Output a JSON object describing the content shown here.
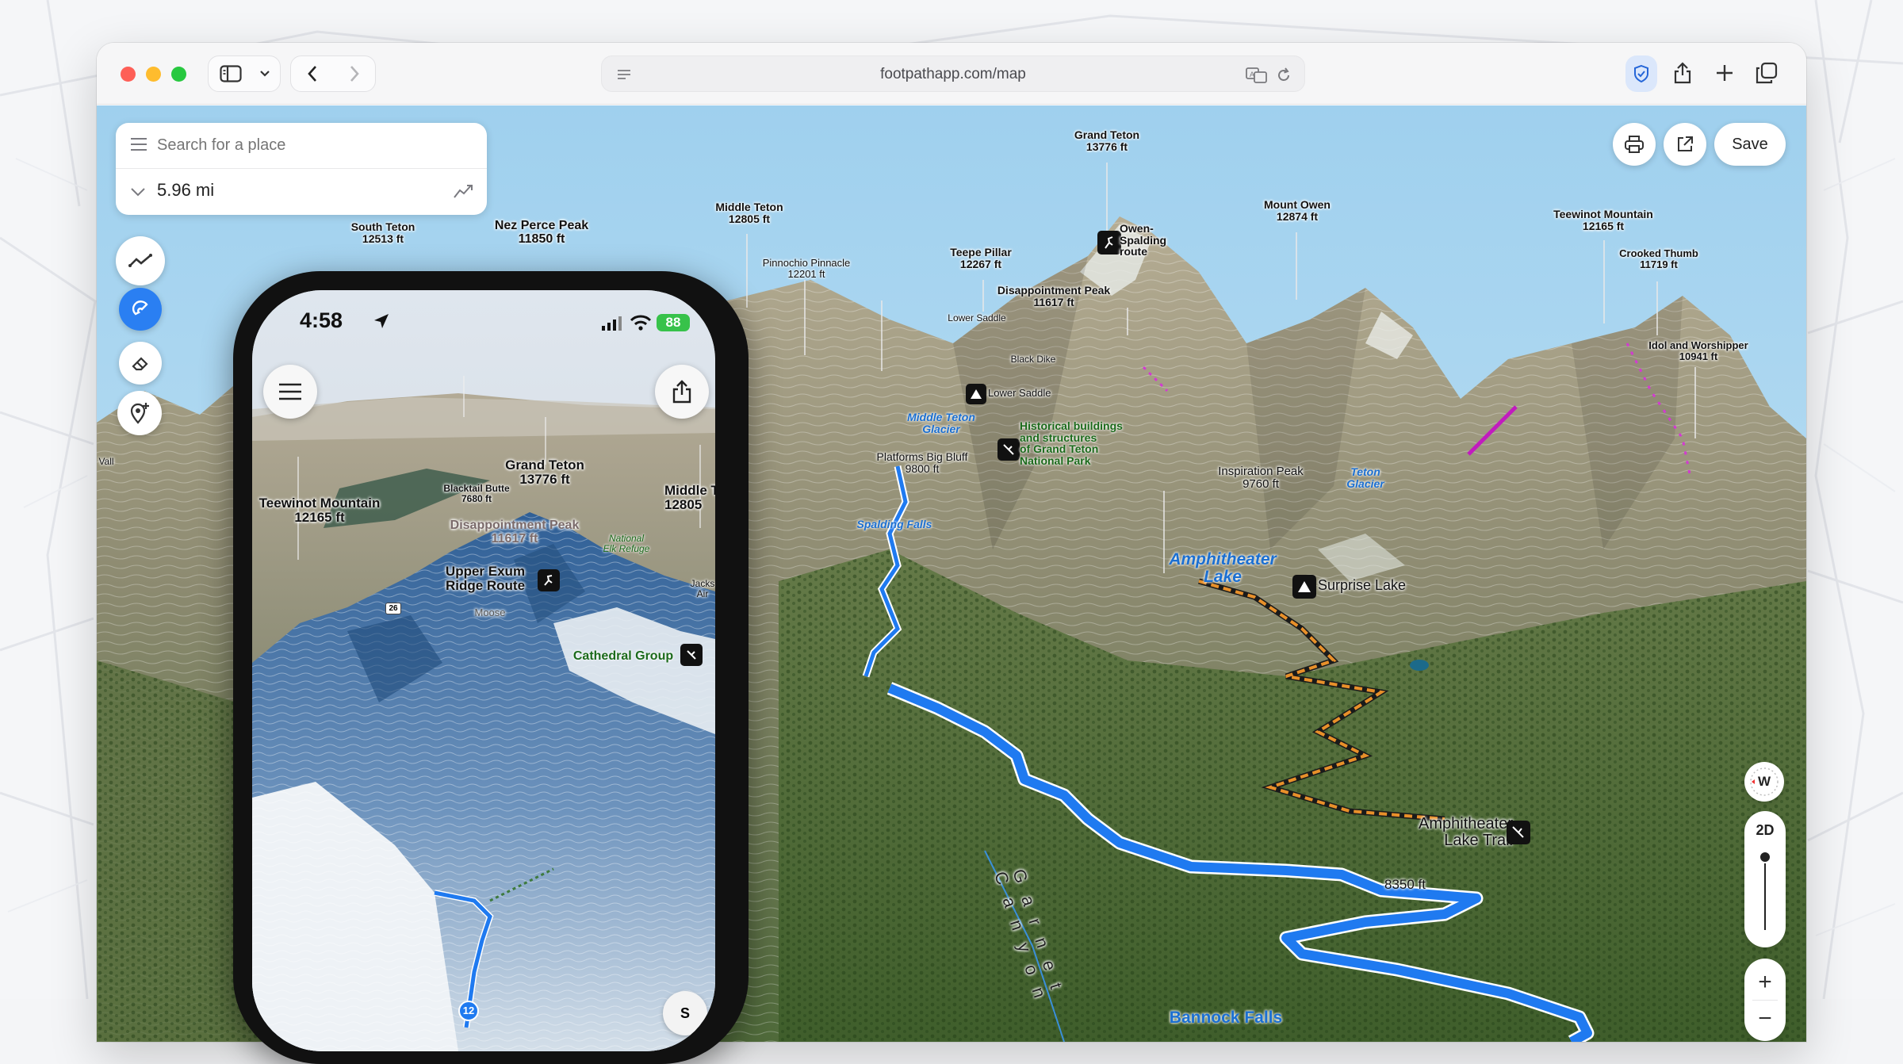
{
  "browser": {
    "url": "footpathapp.com/map"
  },
  "search": {
    "placeholder": "Search for a place",
    "distance": "5.96 mi"
  },
  "toolbar": {
    "save_label": "Save"
  },
  "map_controls": {
    "compass_heading": "W",
    "view_mode": "2D",
    "zoom_in": "+",
    "zoom_out": "−"
  },
  "map_labels": {
    "grand_teton": [
      "Grand Teton",
      "13776 ft"
    ],
    "middle_teton": [
      "Middle Teton",
      "12805 ft"
    ],
    "south_teton": [
      "South Teton",
      "12513 ft"
    ],
    "nez_perce": [
      "Nez Perce Peak",
      "11850 ft"
    ],
    "pinnochio": [
      "Pinnochio Pinnacle",
      "12201 ft"
    ],
    "teepe": [
      "Teepe Pillar",
      "12267 ft"
    ],
    "disappointment": [
      "Disappointment Peak",
      "11617 ft"
    ],
    "owen_spalding": [
      "Owen-",
      "Spalding",
      "route"
    ],
    "mount_owen": [
      "Mount Owen",
      "12874 ft"
    ],
    "teewinot": [
      "Teewinot Mountain",
      "12165 ft"
    ],
    "crooked_thumb": [
      "Crooked Thumb",
      "11719 ft"
    ],
    "idol": [
      "Idol and Worshipper",
      "10941 ft"
    ],
    "lower_saddle_top": "Lower Saddle",
    "black_dike": "Black Dike",
    "lower_saddle": "Lower Saddle",
    "middle_teton_glacier": [
      "Middle Teton",
      "Glacier"
    ],
    "historical": [
      "Historical buildings",
      "and structures",
      "of Grand Teton",
      "National Park"
    ],
    "platforms": [
      "Platforms Big Bluff",
      "9800 ft"
    ],
    "spalding_falls": "Spalding Falls",
    "inspiration": [
      "Inspiration Peak",
      "9760 ft"
    ],
    "teton_glacier": [
      "Teton",
      "Glacier"
    ],
    "amphitheater_lake": [
      "Amphitheater",
      "Lake"
    ],
    "surprise_lake": "Surprise Lake",
    "amphitheater_trail": [
      "Amphitheater",
      "Lake Trail"
    ],
    "elevation_8350": "8350 ft",
    "garnet_canyon": "Garnet Canyon",
    "bannock_falls": "Bannock Falls",
    "edge_left": "Vall"
  },
  "phone": {
    "time": "4:58",
    "battery": "88",
    "labels": {
      "grand_teton": [
        "Grand Teton",
        "13776 ft"
      ],
      "teewinot": [
        "Teewinot Mountain",
        "12165 ft"
      ],
      "blacktail": [
        "Blacktail Butte",
        "7680 ft"
      ],
      "disappointment": [
        "Disappointment Peak",
        "11617 ft"
      ],
      "middle": [
        "Middle T",
        "12805"
      ],
      "upper_exum": [
        "Upper Exum",
        "Ridge Route"
      ],
      "national_elk": [
        "National",
        "Elk Refuge"
      ],
      "jackson": [
        "Jacks",
        "Air"
      ],
      "moose": "Moose",
      "route26": "26",
      "cathedral": "Cathedral Group",
      "waypoint": "12",
      "compass": "S"
    }
  }
}
